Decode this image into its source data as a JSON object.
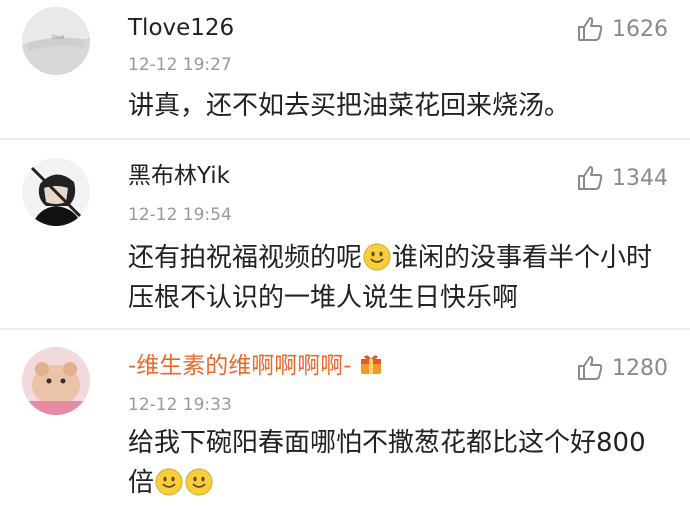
{
  "comments": [
    {
      "username": "Tlove126",
      "time": "12-12 19:27",
      "likes": "1626",
      "text": "讲真，还不如去买把油菜花回来烧汤。"
    },
    {
      "username": "黑布林Yik",
      "time": "12-12 19:54",
      "likes": "1344",
      "text_part1": "还有拍祝福视频的呢",
      "text_part2": "谁闲的没事看半个小时压根不认识的一堆人说生日快乐啊"
    },
    {
      "username": "-维生素的维啊啊啊啊-",
      "time": "12-12 19:33",
      "likes": "1280",
      "text": "给我下碗阳春面哪怕不撒葱花都比这个好800倍"
    }
  ],
  "colors": {
    "username_highlight": "#e8692b",
    "time": "#999999",
    "like": "#8a8a8a"
  },
  "icons": {
    "like": "thumbs-up-icon",
    "emoji": "smile-emoji",
    "badge": "vip-badge-icon"
  }
}
